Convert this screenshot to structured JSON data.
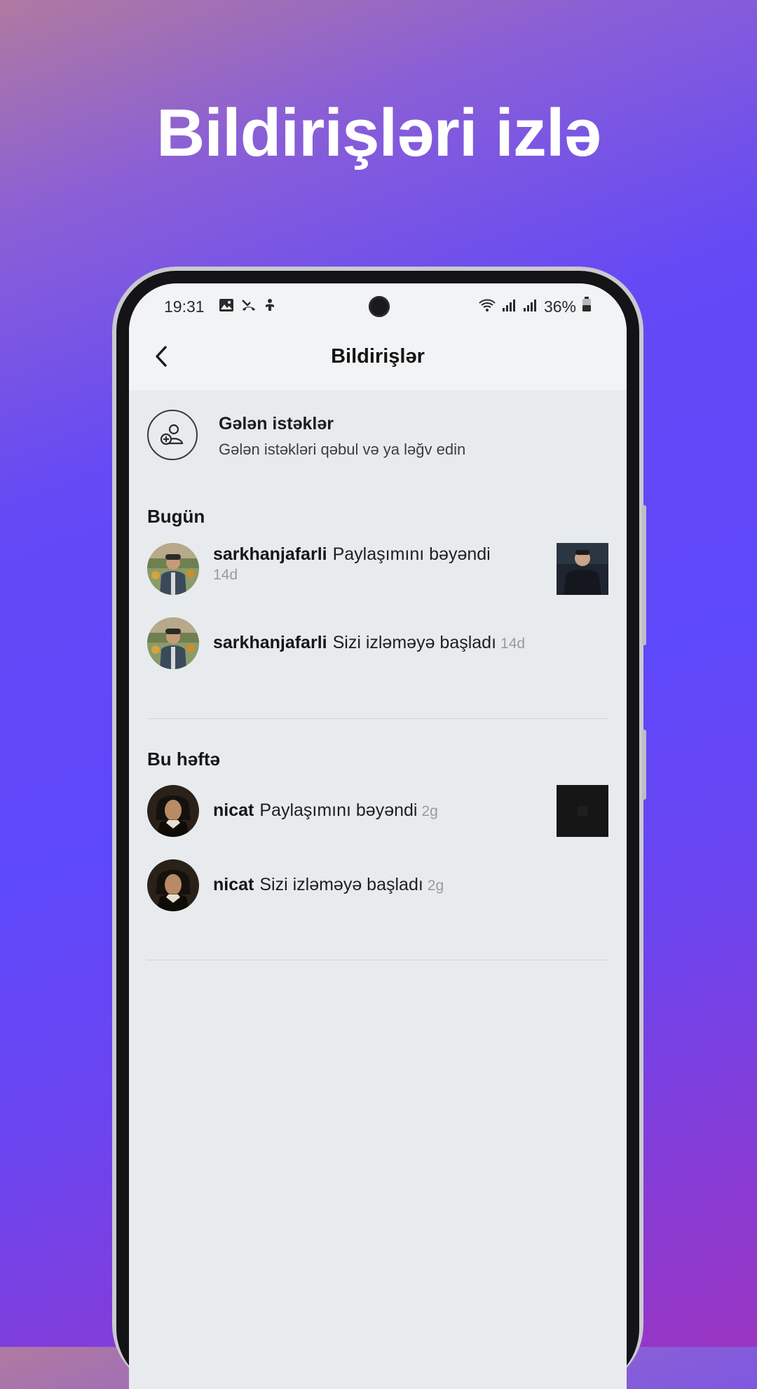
{
  "headline": "Bildirişləri izlə",
  "status_bar": {
    "time": "19:31",
    "battery": "36%"
  },
  "app_bar": {
    "title": "Bildirişlər"
  },
  "requests": {
    "title": "Gələn istəklər",
    "subtitle": "Gələn istəkləri qəbul və ya ləğv edin"
  },
  "sections": [
    {
      "title": "Bugün",
      "items": [
        {
          "username": "sarkhanjafarli",
          "action": "Paylaşımını bəyəndi",
          "time": "14d"
        },
        {
          "username": "sarkhanjafarli",
          "action": "Sizi izləməyə başladı",
          "time": "14d"
        }
      ]
    },
    {
      "title": "Bu həftə",
      "items": [
        {
          "username": "nicat",
          "action": "Paylaşımını bəyəndi",
          "time": "2g"
        },
        {
          "username": "nicat",
          "action": "Sizi izləməyə başladı",
          "time": "2g"
        }
      ]
    }
  ],
  "colors": {
    "accent_purple": "#5e48fb",
    "screen_bg": "#e8ebee",
    "bar_bg": "#f1f3f5"
  }
}
